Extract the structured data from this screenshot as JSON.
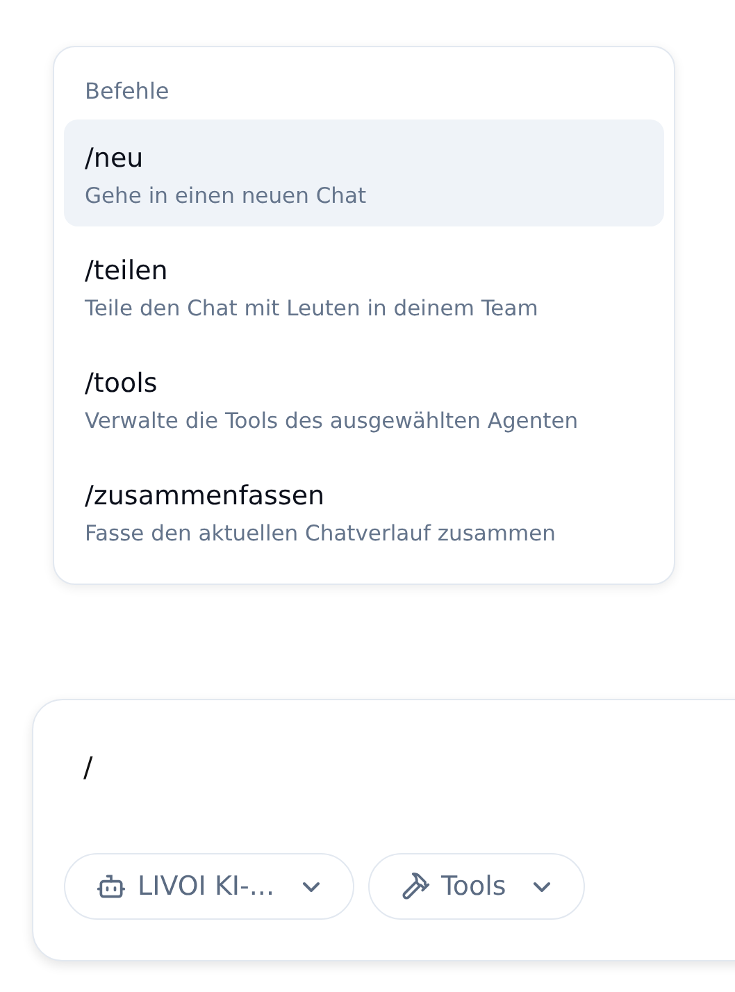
{
  "command_menu": {
    "title": "Befehle",
    "items": [
      {
        "command": "/neu",
        "description": "Gehe in einen neuen Chat",
        "selected": true
      },
      {
        "command": "/teilen",
        "description": "Teile den Chat mit Leuten in deinem Team",
        "selected": false
      },
      {
        "command": "/tools",
        "description": "Verwalte die Tools des ausgewählten Agenten",
        "selected": false
      },
      {
        "command": "/zusammenfassen",
        "description": "Fasse den aktuellen Chatverlauf zusammen",
        "selected": false
      }
    ]
  },
  "composer": {
    "value": "/",
    "buttons": [
      {
        "kind": "agent",
        "label": "LIVOI KI-..."
      },
      {
        "kind": "tools",
        "label": "Tools"
      }
    ]
  }
}
